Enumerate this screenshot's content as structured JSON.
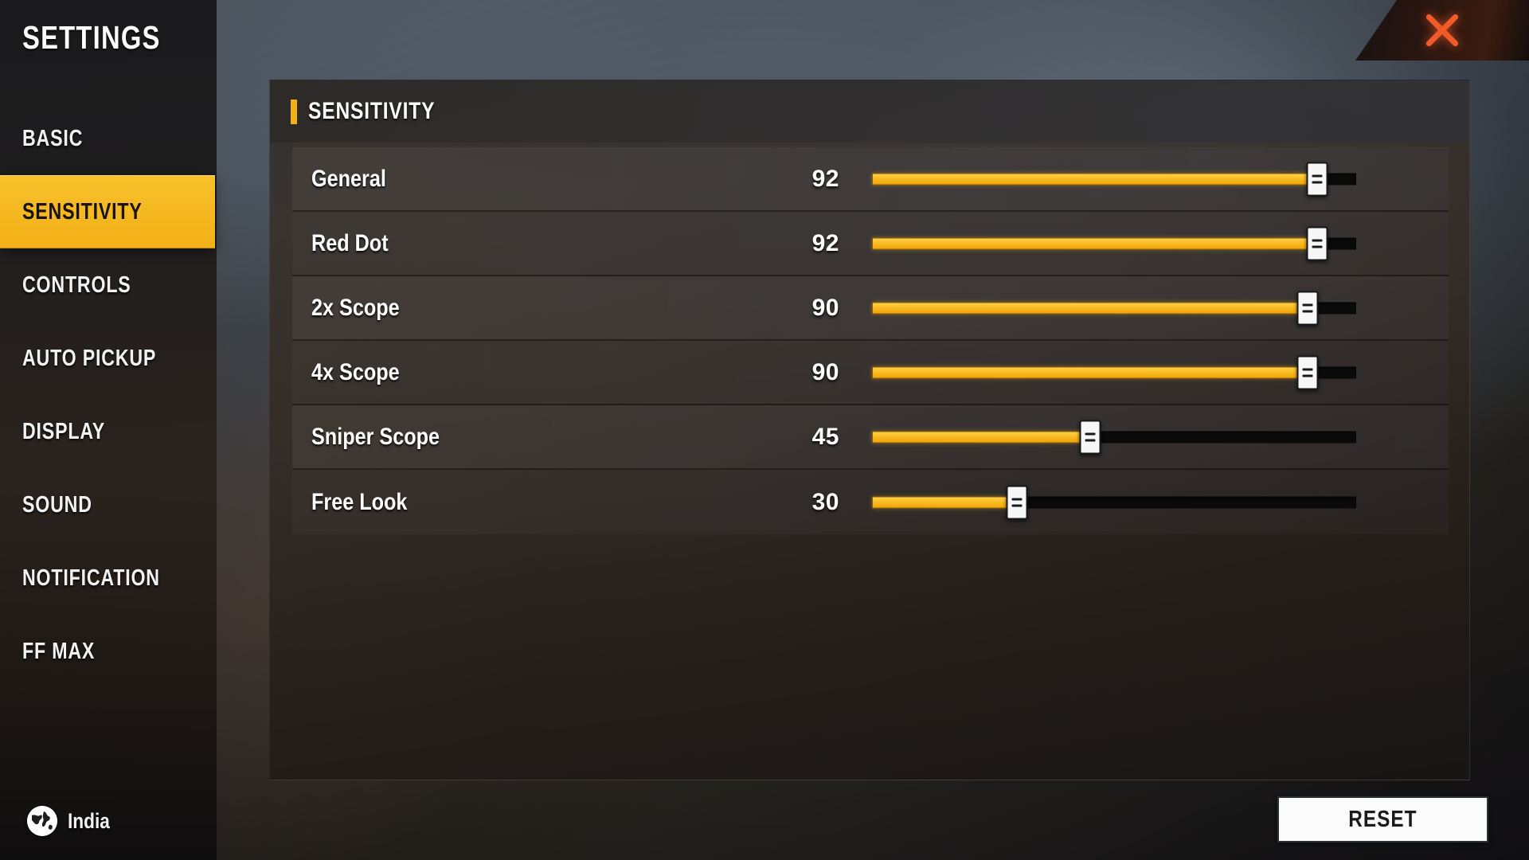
{
  "window": {
    "title": "SETTINGS",
    "close_icon": "close-icon"
  },
  "sidebar": {
    "items": [
      {
        "label": "BASIC",
        "active": false
      },
      {
        "label": "SENSITIVITY",
        "active": true
      },
      {
        "label": "CONTROLS",
        "active": false
      },
      {
        "label": "AUTO PICKUP",
        "active": false
      },
      {
        "label": "DISPLAY",
        "active": false
      },
      {
        "label": "SOUND",
        "active": false
      },
      {
        "label": "NOTIFICATION",
        "active": false
      },
      {
        "label": "FF MAX",
        "active": false
      }
    ],
    "region": {
      "icon": "globe-icon",
      "label": "India"
    }
  },
  "panel": {
    "title": "SENSITIVITY",
    "accent_color": "#F3B017",
    "rows": [
      {
        "label": "General",
        "value": "92",
        "percent": 92
      },
      {
        "label": "Red Dot",
        "value": "92",
        "percent": 92
      },
      {
        "label": "2x Scope",
        "value": "90",
        "percent": 90
      },
      {
        "label": "4x Scope",
        "value": "90",
        "percent": 90
      },
      {
        "label": "Sniper Scope",
        "value": "45",
        "percent": 45
      },
      {
        "label": "Free Look",
        "value": "30",
        "percent": 30
      }
    ]
  },
  "footer": {
    "reset_label": "RESET"
  },
  "colors": {
    "accent": "#F3B017",
    "slider_fill": "#F9BC23",
    "slider_track": "#0a0a0a",
    "close_x": "#f15a29",
    "highlight_text": "#191409"
  }
}
